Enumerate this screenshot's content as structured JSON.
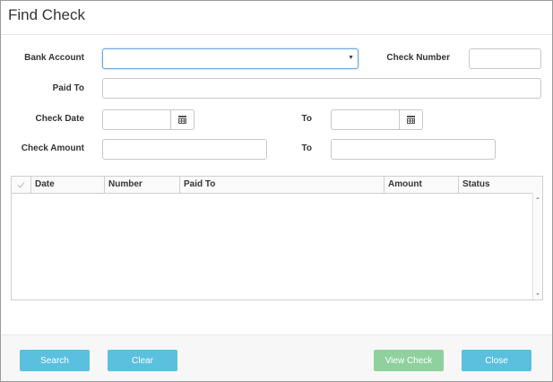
{
  "dialog": {
    "title": "Find Check"
  },
  "form": {
    "bank_account": {
      "label": "Bank Account",
      "value": ""
    },
    "check_number": {
      "label": "Check Number",
      "value": ""
    },
    "paid_to": {
      "label": "Paid To",
      "value": ""
    },
    "check_date": {
      "label": "Check Date",
      "from": "",
      "to_label": "To",
      "to": ""
    },
    "check_amount": {
      "label": "Check Amount",
      "from": "",
      "to_label": "To",
      "to": ""
    }
  },
  "grid": {
    "columns": [
      "Date",
      "Number",
      "Paid To",
      "Amount",
      "Status"
    ],
    "rows": []
  },
  "buttons": {
    "search": "Search",
    "clear": "Clear",
    "view_check": "View Check",
    "close": "Close"
  },
  "colors": {
    "primary_button": "#5bc0de",
    "success_button": "#8fd19e"
  },
  "icons": [
    "calendar-icon",
    "chevron-down-icon",
    "checkmark-icon",
    "scroll-up-icon",
    "scroll-down-icon"
  ]
}
